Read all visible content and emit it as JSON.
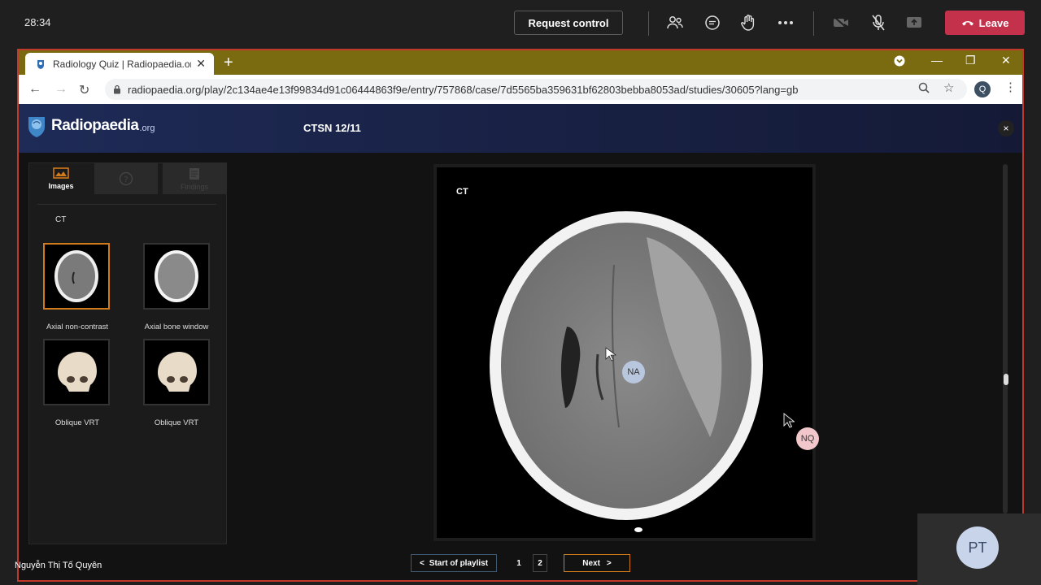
{
  "teams": {
    "timer": "28:34",
    "request_control": "Request control",
    "leave": "Leave",
    "presenter_name": "Nguyễn Thị Tố Quyên",
    "participant_initials": "PT",
    "icons": [
      "people-icon",
      "chat-icon",
      "raise-hand-icon",
      "more-icon",
      "camera-off-icon",
      "mic-off-icon",
      "share-icon"
    ]
  },
  "browser": {
    "tab_title": "Radiology Quiz | Radiopaedia.org",
    "url": "radiopaedia.org/play/2c134ae4e13f99834d91c06444863f9e/entry/757868/case/7d5565ba359631bf62803bebba8053ad/studies/30605?lang=gb",
    "profile_initial": "Q"
  },
  "radiopaedia": {
    "brand": "Radiopaedia",
    "brand_suffix": ".org",
    "title": "CTSN 12/11",
    "close": "×"
  },
  "sidepanel": {
    "tabs": [
      {
        "label": "Images"
      },
      {
        "label": ""
      },
      {
        "label": "Findings"
      }
    ],
    "section": "CT",
    "thumbnails": [
      {
        "label": "Axial non-contrast",
        "kind": "ct-slice"
      },
      {
        "label": "Axial bone window",
        "kind": "bone-slice"
      },
      {
        "label": "Oblique VRT",
        "kind": "skull-3d"
      },
      {
        "label": "Oblique VRT",
        "kind": "skull-3d"
      }
    ]
  },
  "viewer": {
    "modality_label": "CT"
  },
  "cursors": {
    "na": "NA",
    "nq": "NQ"
  },
  "pager": {
    "start": "Start of playlist",
    "pages": [
      "1",
      "2"
    ],
    "next": "Next"
  },
  "colors": {
    "leave_red": "#c4314b",
    "share_border": "#c0392b",
    "selected_orange": "#d07a1a",
    "chrome_tabstrip": "#7a6a10"
  }
}
